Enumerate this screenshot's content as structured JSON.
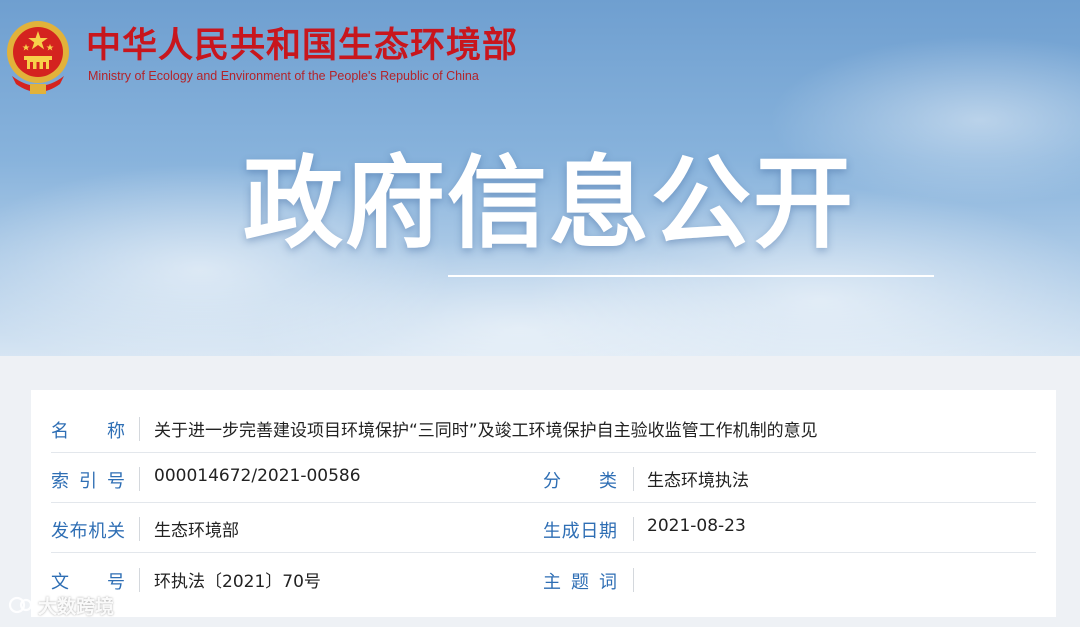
{
  "header": {
    "ministry_cn": "中华人民共和国生态环境部",
    "ministry_en": "Ministry of Ecology and Environment of the People's Republic of China",
    "banner_title": "政府信息公开"
  },
  "info": {
    "name_label": "名称",
    "name_value": "关于进一步完善建设项目环境保护“三同时”及竣工环境保护自主验收监管工作机制的意见",
    "index_label": "索引号",
    "index_value": "000014672/2021-00586",
    "category_label": "分类",
    "category_value": "生态环境执法",
    "issuer_label": "发布机关",
    "issuer_value": "生态环境部",
    "date_label": "生成日期",
    "date_value": "2021-08-23",
    "docno_label": "文号",
    "docno_value": "环执法〔2021〕70号",
    "subject_label": "主题词",
    "subject_value": ""
  },
  "watermark": {
    "text": "大数跨境"
  },
  "colors": {
    "brand_red": "#c8161d",
    "label_blue": "#2e6eb4",
    "banner_blue": "#88b3dc"
  }
}
